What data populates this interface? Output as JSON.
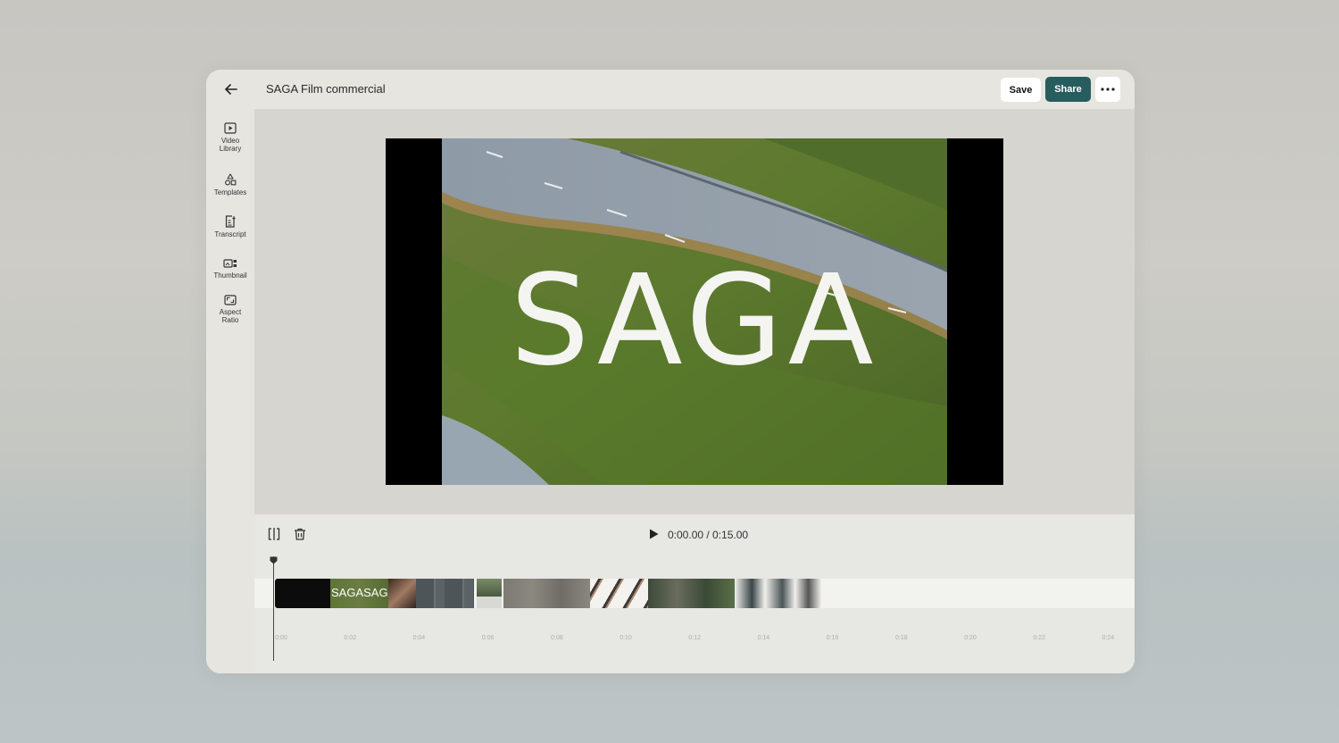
{
  "header": {
    "back_icon": "arrow-left-icon",
    "title": "SAGA Film commercial",
    "save_label": "Save",
    "share_label": "Share",
    "share_color": "#285d5f",
    "more_icon": "ellipsis-icon"
  },
  "sidebar": {
    "items": [
      {
        "label_line1": "Video",
        "label_line2": "Library",
        "icon": "video-library-icon"
      },
      {
        "label_line1": "Templates",
        "label_line2": "",
        "icon": "shapes-icon"
      },
      {
        "label_line1": "Transcript",
        "label_line2": "",
        "icon": "transcript-icon"
      },
      {
        "label_line1": "Thumbnail",
        "label_line2": "",
        "icon": "thumbnail-icon"
      },
      {
        "label_line1": "Aspect",
        "label_line2": "Ratio",
        "icon": "aspect-ratio-icon"
      }
    ]
  },
  "preview": {
    "overlay_text": "SAGA"
  },
  "timeline": {
    "split_icon": "split-icon",
    "delete_icon": "trash-icon",
    "play_icon": "play-icon",
    "timecode": "0:00.00 / 0:15.00",
    "clip_overlay_text": "SAGASAGA",
    "ruler": [
      "0:00",
      "0:02",
      "0:04",
      "0:06",
      "0:08",
      "0:10",
      "0:12",
      "0:14",
      "0:16",
      "0:18",
      "0:20",
      "0:22",
      "0:24"
    ]
  }
}
